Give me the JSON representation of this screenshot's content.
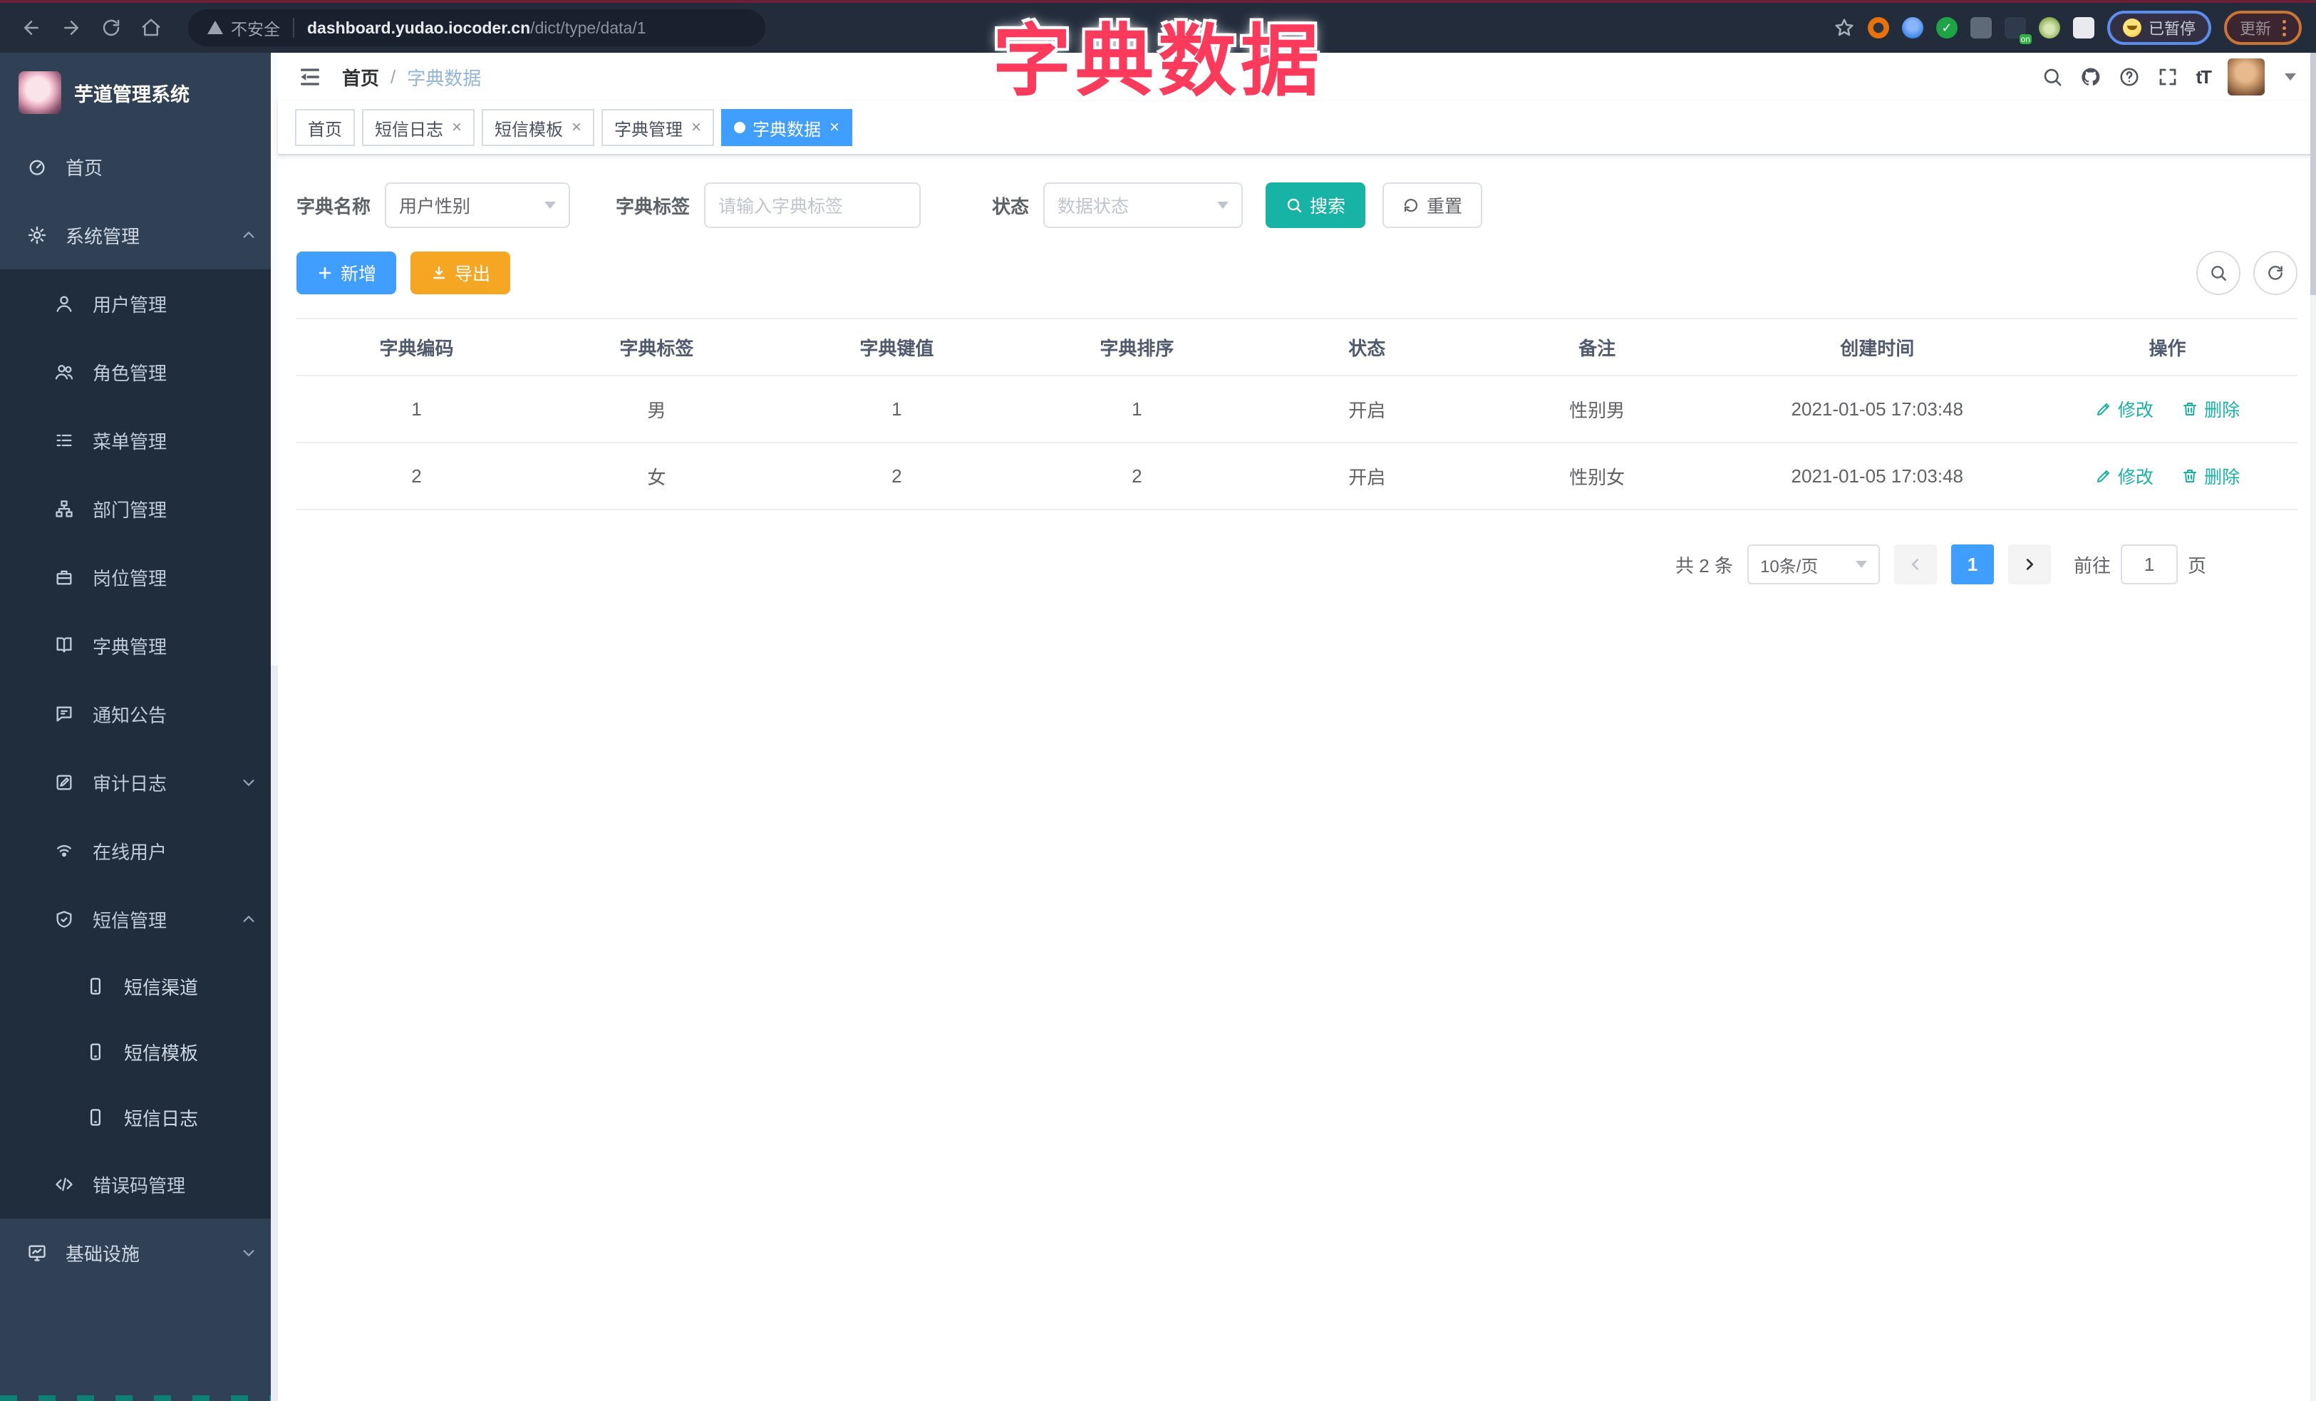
{
  "browser": {
    "security_label": "不安全",
    "url_host": "dashboard.yudao.iocoder.cn",
    "url_path": "/dict/type/data/1",
    "paused_label": "已暂停",
    "update_label": "更新"
  },
  "overlay_title": "字典数据",
  "colors": {
    "accent_blue": "#409EFF",
    "teal_action": "#17B3A4",
    "warning_orange": "#F5A623",
    "sidebar_bg": "#304156",
    "submenu_bg": "#1F2D3D",
    "overlay_pink": "#FB3A5C",
    "active_tab": "#409EFF"
  },
  "glyphs": {
    "breadcrumb_separator": "/",
    "tab_close": "×",
    "font_size_icon": "tT",
    "ext_check": "✓"
  },
  "sidebar": {
    "logo_title": "芋道管理系统",
    "items": [
      {
        "label": "首页"
      },
      {
        "label": "系统管理"
      },
      {
        "label": "用户管理"
      },
      {
        "label": "角色管理"
      },
      {
        "label": "菜单管理"
      },
      {
        "label": "部门管理"
      },
      {
        "label": "岗位管理"
      },
      {
        "label": "字典管理"
      },
      {
        "label": "通知公告"
      },
      {
        "label": "审计日志"
      },
      {
        "label": "在线用户"
      },
      {
        "label": "短信管理"
      },
      {
        "label": "短信渠道"
      },
      {
        "label": "短信模板"
      },
      {
        "label": "短信日志"
      },
      {
        "label": "错误码管理"
      },
      {
        "label": "基础设施"
      }
    ]
  },
  "navbar": {
    "breadcrumb_home": "首页",
    "breadcrumb_current": "字典数据"
  },
  "tabs": [
    {
      "label": "首页"
    },
    {
      "label": "短信日志"
    },
    {
      "label": "短信模板"
    },
    {
      "label": "字典管理"
    },
    {
      "label": "字典数据"
    }
  ],
  "filters": {
    "name_label": "字典名称",
    "name_value": "用户性别",
    "label_label": "字典标签",
    "label_placeholder": "请输入字典标签",
    "status_label": "状态",
    "status_placeholder": "数据状态",
    "search_label": "搜索",
    "reset_label": "重置"
  },
  "toolbar": {
    "add_label": "新增",
    "export_label": "导出"
  },
  "table": {
    "headers": [
      "字典编码",
      "字典标签",
      "字典键值",
      "字典排序",
      "状态",
      "备注",
      "创建时间",
      "操作"
    ],
    "edit_label": "修改",
    "delete_label": "删除",
    "rows": [
      {
        "code": "1",
        "label": "男",
        "value": "1",
        "sort": "1",
        "status": "开启",
        "remark": "性别男",
        "created": "2021-01-05 17:03:48"
      },
      {
        "code": "2",
        "label": "女",
        "value": "2",
        "sort": "2",
        "status": "开启",
        "remark": "性别女",
        "created": "2021-01-05 17:03:48"
      }
    ]
  },
  "pagination": {
    "total_label": "共 2 条",
    "page_size_label": "10条/页",
    "current_page": "1",
    "goto_label": "前往",
    "goto_value": "1",
    "page_suffix": "页"
  }
}
